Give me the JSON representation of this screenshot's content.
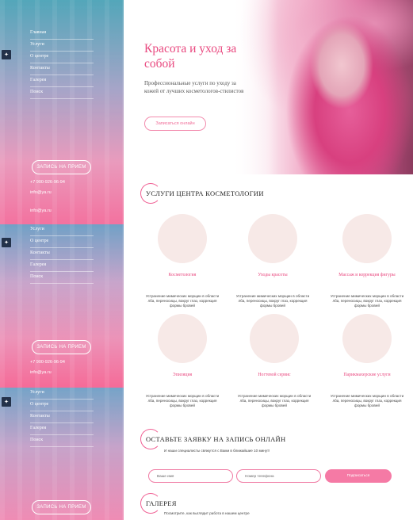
{
  "sidebar": {
    "sections": [
      {
        "menu": [
          "Главная",
          "Услуги",
          "О центре",
          "Контакты",
          "Галерея",
          "Поиск"
        ],
        "cta": "ЗАПИСЬ НА ПРИЕМ",
        "phone": "+7 900-926-96-94",
        "email": "info@ya.ru",
        "email2": "info@ya.ru"
      },
      {
        "menu": [
          "Услуги",
          "О центре",
          "Контакты",
          "Галерея",
          "Поиск"
        ],
        "cta": "ЗАПИСЬ НА ПРИЕМ",
        "phone": "+7 900-926-96-94",
        "email": "info@ya.ru"
      },
      {
        "menu": [
          "Услуги",
          "О центре",
          "Контакты",
          "Галерея",
          "Поиск"
        ],
        "cta": "ЗАПИСЬ НА ПРИЕМ"
      }
    ]
  },
  "hero": {
    "title": "Красота и уход за собой",
    "subtitle": "Профессиональные услуги по уходу за кожей от лучших косметологов-стилистов",
    "button": "Записаться онлайн"
  },
  "services": {
    "heading": "УСЛУГИ ЦЕНТРА КОСМЕТОЛОГИИ",
    "items": [
      {
        "name": "Косметология",
        "desc": "Устранение мимических морщин в области лба, переносицы, вокруг глаз, коррекция формы бровей",
        "icon": "face-photo"
      },
      {
        "name": "Уходы красоты",
        "desc": "Устранение мимических морщин в области лба, переносицы, вокруг глаз, коррекция формы бровей",
        "icon": "face-photo"
      },
      {
        "name": "Массаж и коррекция фигуры",
        "desc": "Устранение мимических морщин в области лба, переносицы, вокруг глаз, коррекция формы бровей",
        "icon": "massage-photo"
      },
      {
        "name": "Эпиляция",
        "desc": "Устранение мимических морщин в области лба, переносицы, вокруг глаз, коррекция формы бровей",
        "icon": "legs-photo"
      },
      {
        "name": "Ногтевой сервис",
        "desc": "Устранение мимических морщин в области лба, переносицы, вокруг глаз, коррекция формы бровей",
        "icon": "nails-photo"
      },
      {
        "name": "Парикмахерские услуги",
        "desc": "Устранение мимических морщин в области лба, переносицы, вокруг глаз, коррекция формы бровей",
        "icon": "hair-photo"
      }
    ]
  },
  "booking": {
    "heading": "ОСТАВЬТЕ ЗАЯВКУ НА ЗАПИСЬ ОНЛАЙН",
    "note": "И наши специалисты свяжутся с Вами в ближайшие 10 минут!",
    "name_placeholder": "Ваше имя",
    "phone_placeholder": "Номер телефона",
    "submit": "Подписаться"
  },
  "gallery": {
    "heading": "ГАЛЕРЕЯ",
    "note": "Посмотрите, как выглядит работа в нашем центре"
  },
  "colors": {
    "accent": "#e9487f",
    "button": "#f57aa5",
    "sidebar_top": "#4fa3b4",
    "sidebar_bottom": "#f06a98"
  }
}
